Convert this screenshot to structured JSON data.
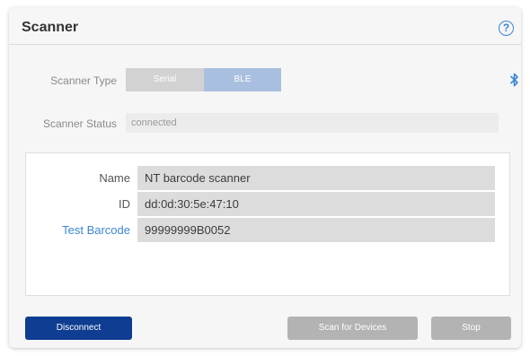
{
  "card": {
    "title": "Scanner",
    "help_icon": "?"
  },
  "scanner_type": {
    "label": "Scanner Type",
    "options": [
      "Serial",
      "BLE"
    ],
    "selected": "BLE",
    "icon": "bluetooth-icon"
  },
  "scanner_status": {
    "label": "Scanner Status",
    "value": "connected"
  },
  "device": {
    "rows": [
      {
        "label": "Name",
        "value": "NT barcode scanner"
      },
      {
        "label": "ID",
        "value": "dd:0d:30:5e:47:10"
      },
      {
        "label": "Test Barcode",
        "value": "99999999B0052"
      }
    ]
  },
  "actions": {
    "disconnect": "Disconnect",
    "scan": "Scan for Devices",
    "stop": "Stop"
  },
  "colors": {
    "primary": "#0f3d91",
    "accent": "#3a86d4",
    "ble_selected": "#a9bfe0",
    "disabled": "#b3b3b3"
  }
}
